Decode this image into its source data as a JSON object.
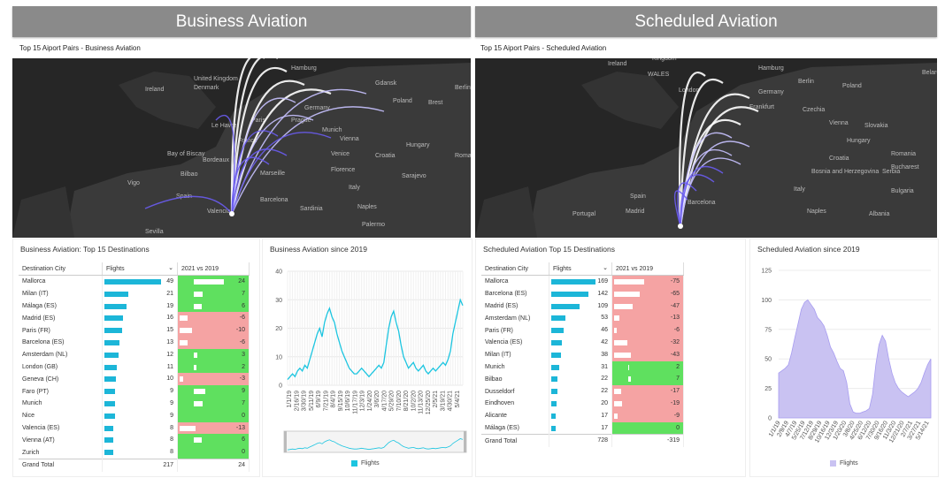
{
  "business": {
    "banner": "Business Aviation",
    "map_title": "Top 15 Aiport Pairs - Business Aviation",
    "map_labels": [
      "Ireland",
      "United Kingdom",
      "Denmark",
      "Hamburg",
      "Gdansk",
      "Berlin",
      "Poland",
      "Brest",
      "Germany",
      "Munich",
      "Prague",
      "Hungary",
      "Vienna",
      "Le Havre",
      "Paris",
      "France",
      "Bordeaux",
      "Bilbao",
      "Marseille",
      "Venice",
      "Florence",
      "Croatia",
      "Sarajevo",
      "Roma",
      "Italy",
      "Vigo",
      "Spain",
      "Valencia",
      "Barcelona",
      "Sevilla",
      "Sardinia",
      "Naples",
      "Palermo",
      "Bay of Biscay"
    ],
    "table_title": "Business Aviation: Top 15 Destinations",
    "headers": {
      "city": "Destination City",
      "flights": "Flights",
      "chg": "2021 vs 2019"
    },
    "rows": [
      {
        "city": "Mallorca",
        "flights": 49,
        "chg": 24
      },
      {
        "city": "Milan (IT)",
        "flights": 21,
        "chg": 7
      },
      {
        "city": "Málaga (ES)",
        "flights": 19,
        "chg": 6
      },
      {
        "city": "Madrid (ES)",
        "flights": 16,
        "chg": -6
      },
      {
        "city": "Paris (FR)",
        "flights": 15,
        "chg": -10
      },
      {
        "city": "Barcelona (ES)",
        "flights": 13,
        "chg": -6
      },
      {
        "city": "Amsterdam (NL)",
        "flights": 12,
        "chg": 3
      },
      {
        "city": "London (GB)",
        "flights": 11,
        "chg": 2
      },
      {
        "city": "Geneva (CH)",
        "flights": 10,
        "chg": -3
      },
      {
        "city": "Faro (PT)",
        "flights": 9,
        "chg": 9
      },
      {
        "city": "Munich",
        "flights": 9,
        "chg": 7
      },
      {
        "city": "Nice",
        "flights": 9,
        "chg": 0
      },
      {
        "city": "Valencia (ES)",
        "flights": 8,
        "chg": -13
      },
      {
        "city": "Vienna (AT)",
        "flights": 8,
        "chg": 6
      },
      {
        "city": "Zurich",
        "flights": 8,
        "chg": 0
      }
    ],
    "total": {
      "label": "Grand Total",
      "flights": 217,
      "chg": 24
    },
    "chart_title": "Business Aviation since 2019",
    "legend": "Flights"
  },
  "scheduled": {
    "banner": "Scheduled Aviation",
    "map_title": "Top 15 Aiport Pairs - Scheduled Aviation",
    "map_labels": [
      "Ireland",
      "Kingdom",
      "WALES",
      "Hamburg",
      "Berlin",
      "Poland",
      "Belarus",
      "London",
      "Germany",
      "Frankfurt",
      "Czechia",
      "Vienna",
      "Slovakia",
      "Hungary",
      "Romania",
      "Croatia",
      "Bosnia and Herzegovina",
      "Serbia",
      "Bucharest",
      "Bulgaria",
      "Italy",
      "Spain",
      "Portugal",
      "Madrid",
      "Barcelona",
      "Naples",
      "Albania"
    ],
    "table_title": "Scheduled Aviation Top 15 Destinations",
    "headers": {
      "city": "Destination City",
      "flights": "Flights",
      "chg": "2021 vs 2019"
    },
    "rows": [
      {
        "city": "Mallorca",
        "flights": 169,
        "chg": -75
      },
      {
        "city": "Barcelona (ES)",
        "flights": 142,
        "chg": -65
      },
      {
        "city": "Madrid (ES)",
        "flights": 109,
        "chg": -47
      },
      {
        "city": "Amsterdam (NL)",
        "flights": 53,
        "chg": -13
      },
      {
        "city": "Paris (FR)",
        "flights": 46,
        "chg": -6
      },
      {
        "city": "Valencia (ES)",
        "flights": 42,
        "chg": -32
      },
      {
        "city": "Milan (IT)",
        "flights": 38,
        "chg": -43
      },
      {
        "city": "Munich",
        "flights": 31,
        "chg": 2
      },
      {
        "city": "Bilbao",
        "flights": 22,
        "chg": 7
      },
      {
        "city": "Dusseldorf",
        "flights": 22,
        "chg": -17
      },
      {
        "city": "Eindhoven",
        "flights": 20,
        "chg": -19
      },
      {
        "city": "Alicante",
        "flights": 17,
        "chg": -9
      },
      {
        "city": "Málaga (ES)",
        "flights": 17,
        "chg": 0
      }
    ],
    "total": {
      "label": "Grand Total",
      "flights": 728,
      "chg": -319
    },
    "chart_title": "Scheduled Aviation since 2019",
    "legend": "Flights"
  },
  "colors": {
    "bar": "#1cb6d8",
    "pos": "#5fe05f",
    "neg": "#f5a3a3",
    "bizline": "#1cc5e0",
    "schedarea": "#c9c2f2",
    "schedline": "#a79cf0"
  },
  "chart_data": [
    {
      "type": "line",
      "title": "Business Aviation since 2019",
      "ylim": [
        0,
        40
      ],
      "yticks": [
        0,
        10,
        20,
        30,
        40
      ],
      "xticks": [
        "1/1/19",
        "2/16/19",
        "3/30/19",
        "5/11/19",
        "6/9/19",
        "7/21/19",
        "8/4/19",
        "9/15/19",
        "10/6/19",
        "11/17/19",
        "12/3/19",
        "1/24/20",
        "3/6/20",
        "4/17/20",
        "5/29/20",
        "7/10/20",
        "8/21/20",
        "10/2/20",
        "11/13/20",
        "12/25/20",
        "2/5/21",
        "3/19/21",
        "4/30/21",
        "5/4/21"
      ],
      "series": [
        {
          "name": "Flights",
          "values": [
            2,
            3,
            4,
            3,
            5,
            6,
            5,
            7,
            6,
            9,
            12,
            15,
            18,
            20,
            17,
            22,
            25,
            27,
            24,
            22,
            18,
            15,
            12,
            10,
            8,
            6,
            5,
            4,
            4,
            5,
            6,
            5,
            4,
            3,
            4,
            5,
            6,
            7,
            6,
            8,
            14,
            20,
            24,
            26,
            22,
            19,
            14,
            10,
            8,
            6,
            7,
            8,
            6,
            5,
            6,
            7,
            5,
            4,
            5,
            6,
            5,
            6,
            7,
            8,
            7,
            9,
            12,
            18,
            22,
            26,
            30,
            28
          ]
        }
      ]
    },
    {
      "type": "area",
      "title": "Scheduled Aviation since 2019",
      "ylim": [
        0,
        125
      ],
      "yticks": [
        0,
        25,
        50,
        75,
        100,
        125
      ],
      "xticks": [
        "1/1/19",
        "2/9/19",
        "4/7/19",
        "5/25/19",
        "7/12/19",
        "8/29/19",
        "10/16/19",
        "12/3/19",
        "1/20/20",
        "3/8/20",
        "4/25/20",
        "6/12/20",
        "7/30/20",
        "9/16/20",
        "11/3/20",
        "12/21/20",
        "2/7/21",
        "3/27/21",
        "5/14/21"
      ],
      "series": [
        {
          "name": "Flights",
          "values": [
            38,
            40,
            42,
            45,
            55,
            68,
            80,
            92,
            98,
            100,
            96,
            92,
            85,
            82,
            78,
            70,
            60,
            55,
            48,
            42,
            40,
            30,
            12,
            5,
            4,
            4,
            5,
            6,
            8,
            20,
            45,
            62,
            70,
            65,
            50,
            38,
            30,
            25,
            22,
            20,
            18,
            20,
            22,
            25,
            30,
            38,
            45,
            50
          ]
        }
      ]
    }
  ]
}
